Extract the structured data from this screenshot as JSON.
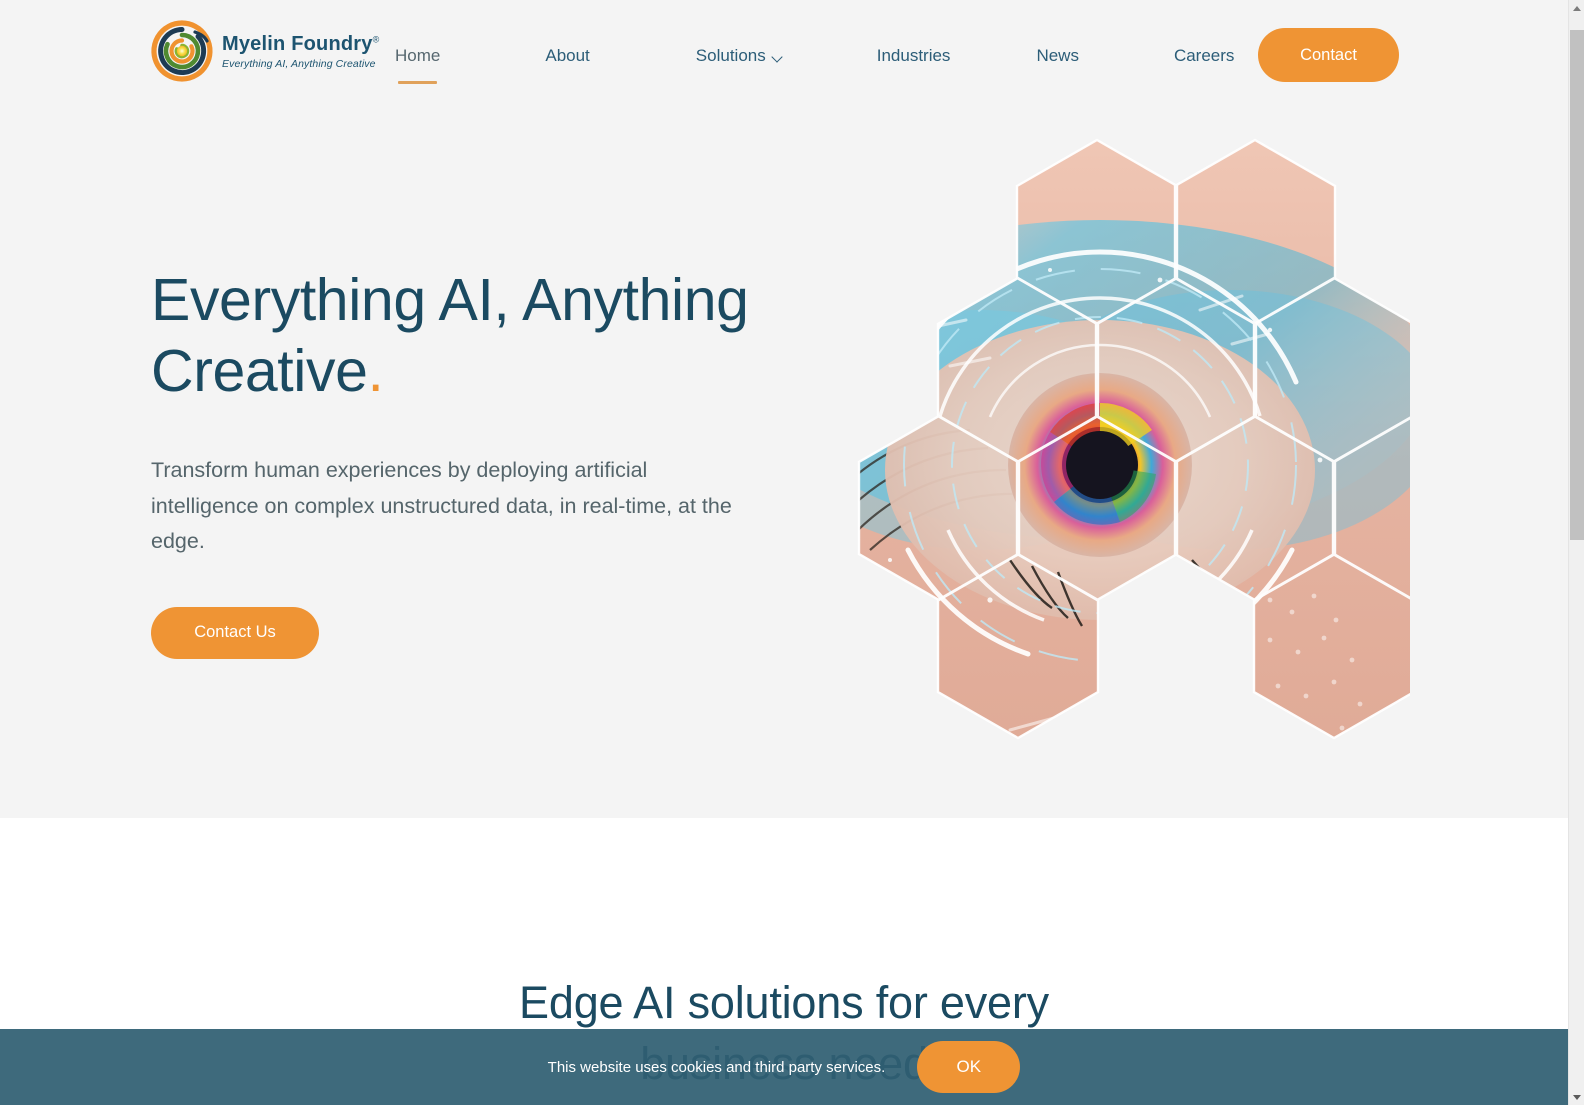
{
  "brand": {
    "name": "Myelin Foundry",
    "registered_mark": "®",
    "tagline": "Everything AI, Anything Creative",
    "logo_icon": "spiral-logo-icon",
    "colors": {
      "outer_ring": "#f0922f",
      "navy": "#1d3b54",
      "green": "#4f8a31",
      "yellow": "#f5d020"
    }
  },
  "nav": {
    "items": [
      {
        "label": "Home",
        "active": true,
        "has_dropdown": false
      },
      {
        "label": "About",
        "active": false,
        "has_dropdown": false
      },
      {
        "label": "Solutions",
        "active": false,
        "has_dropdown": true
      },
      {
        "label": "Industries",
        "active": false,
        "has_dropdown": false
      },
      {
        "label": "News",
        "active": false,
        "has_dropdown": false
      },
      {
        "label": "Careers",
        "active": false,
        "has_dropdown": false
      }
    ],
    "contact_button": "Contact",
    "active_underline_color": "#e0a15a",
    "link_color": "#2c5d78"
  },
  "hero": {
    "title_line_1": "Everything AI, Anything",
    "title_line_2": "Creative",
    "title_dot": ".",
    "subtitle": "Transform human experiences by deploying artificial intelligence on complex unstructured data, in real-time, at the edge.",
    "cta_label": "Contact Us",
    "background_color": "#f4f4f4",
    "heading_color": "#1b4a61",
    "accent_color": "#ef9434",
    "artwork_alt": "hexagonal-honeycomb-eye-image"
  },
  "section_two": {
    "heading_line_1": "Edge AI solutions for every",
    "heading_line_2": "business need",
    "background_color": "#ffffff",
    "heading_color": "#1b4a61"
  },
  "cookie_banner": {
    "message": "This website uses cookies and third party services.",
    "accept_label": "OK",
    "background_color": "#2f5f72",
    "button_color": "#ef9434"
  },
  "scrollbar": {
    "up_arrow": "scroll-up-arrow-icon",
    "down_arrow": "scroll-down-arrow-icon"
  }
}
